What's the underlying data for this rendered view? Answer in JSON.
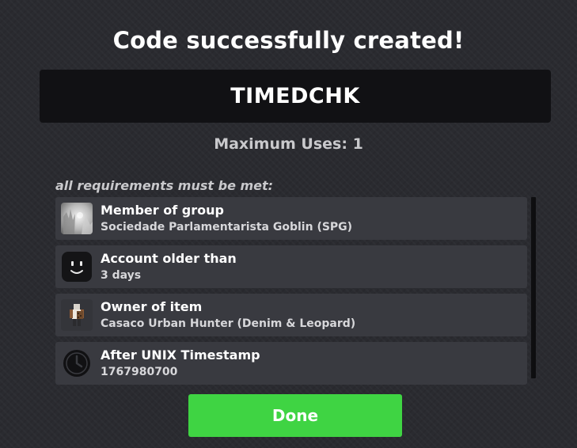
{
  "dialog": {
    "title": "Code successfully created!",
    "code": "TIMEDCHK",
    "max_uses_label": "Maximum Uses: 1"
  },
  "requirements": {
    "heading": "all requirements must be met:",
    "items": [
      {
        "icon": "group-emblem-icon",
        "title": "Member of group",
        "value": "Sociedade Parlamentarista Goblin (SPG)"
      },
      {
        "icon": "avatar-face-icon",
        "title": "Account older than",
        "value": "3 days"
      },
      {
        "icon": "item-thumbnail-icon",
        "title": "Owner of item",
        "value": "Casaco Urban Hunter (Denim & Leopard)"
      },
      {
        "icon": "clock-icon",
        "title": "After UNIX Timestamp",
        "value": "1767980700"
      }
    ]
  },
  "actions": {
    "done_label": "Done"
  },
  "colors": {
    "background": "#2a2b30",
    "code_box": "#111114",
    "list_item": "#393a40",
    "done_button": "#3fd443",
    "muted_text": "#c9c9cc"
  }
}
